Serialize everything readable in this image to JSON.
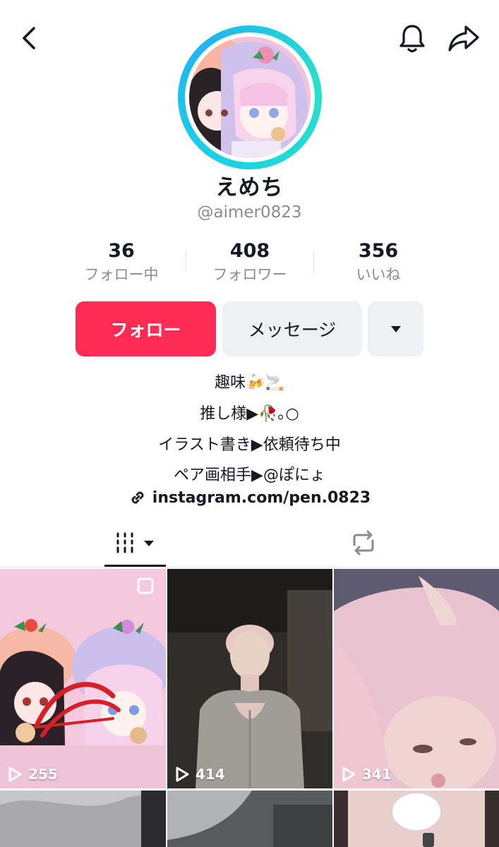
{
  "profile": {
    "display_name": "えめち",
    "handle": "@aimer0823"
  },
  "stats": [
    {
      "value": "36",
      "label": "フォロー中"
    },
    {
      "value": "408",
      "label": "フォロワー"
    },
    {
      "value": "356",
      "label": "いいね"
    }
  ],
  "actions": {
    "follow_label": "フォロー",
    "message_label": "メッセージ"
  },
  "bio": {
    "line1": "趣味🍻🚬",
    "line2": "推し様▶🥀｡○",
    "line3": "イラスト書き▶依頼待ち中",
    "line4": "ペア画相手▶@ぽにょ",
    "link": "instagram.com/pen.0823"
  },
  "tabs": [
    {
      "name": "videos",
      "icon": "grid-icon",
      "selected": true
    },
    {
      "name": "reposts",
      "icon": "repost-icon",
      "selected": false
    }
  ],
  "videos": [
    {
      "views": "255"
    },
    {
      "views": "414"
    },
    {
      "views": "341"
    }
  ],
  "colors": {
    "accent": "#fe2c55",
    "avatar_ring": "#19d3e6",
    "secondary_button": "#eff0f2",
    "muted_text": "#8a8b91"
  }
}
